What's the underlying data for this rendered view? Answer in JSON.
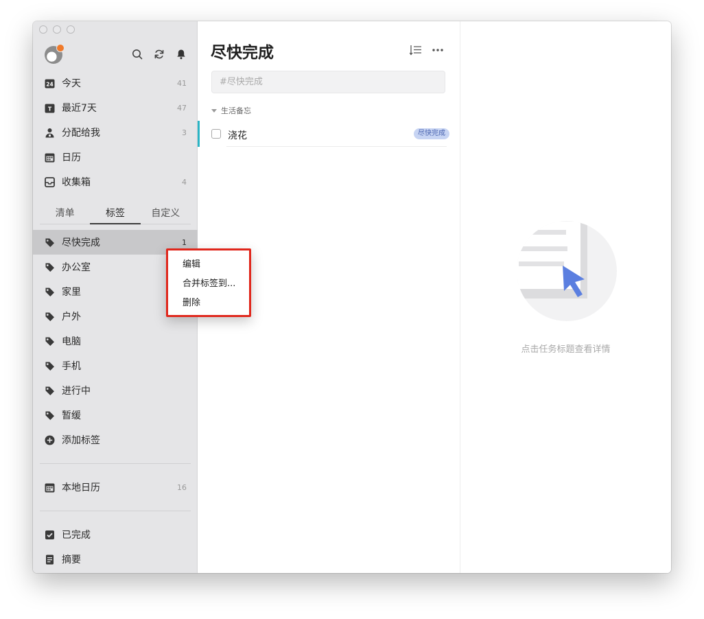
{
  "sidebar": {
    "smart_lists": [
      {
        "label": "今天",
        "count": "41",
        "icon": "calendar-today-icon"
      },
      {
        "label": "最近7天",
        "count": "47",
        "icon": "calendar-week-icon"
      },
      {
        "label": "分配给我",
        "count": "3",
        "icon": "person-icon"
      },
      {
        "label": "日历",
        "count": "",
        "icon": "calendar-icon"
      },
      {
        "label": "收集箱",
        "count": "4",
        "icon": "inbox-icon"
      }
    ],
    "tabs": [
      {
        "label": "清单"
      },
      {
        "label": "标签",
        "active": true
      },
      {
        "label": "自定义"
      }
    ],
    "tags": [
      {
        "label": "尽快完成",
        "count": "1",
        "active": true
      },
      {
        "label": "办公室",
        "count": ""
      },
      {
        "label": "家里",
        "count": ""
      },
      {
        "label": "户外",
        "count": ""
      },
      {
        "label": "电脑",
        "count": ""
      },
      {
        "label": "手机",
        "count": ""
      },
      {
        "label": "进行中",
        "count": ""
      },
      {
        "label": "暂缓",
        "count": ""
      }
    ],
    "add_tag_label": "添加标签",
    "local_calendar": {
      "label": "本地日历",
      "count": "16"
    },
    "completed_label": "已完成",
    "summary_label": "摘要"
  },
  "main": {
    "title": "尽快完成",
    "quick_add_placeholder": "#尽快完成",
    "group_name": "生活备忘",
    "tasks": [
      {
        "title": "浇花",
        "tag": "尽快完成",
        "color": "#2ab4c5"
      }
    ]
  },
  "detail": {
    "empty_text": "点击任务标题查看详情"
  },
  "context_menu": {
    "items": [
      "编辑",
      "合并标签到...",
      "删除"
    ]
  },
  "colors": {
    "accent_bar": "#2ab4c5",
    "tag_bg": "#c7d4f3",
    "highlight_box": "#e0261b",
    "illustration_cursor": "#5b7fe0"
  }
}
